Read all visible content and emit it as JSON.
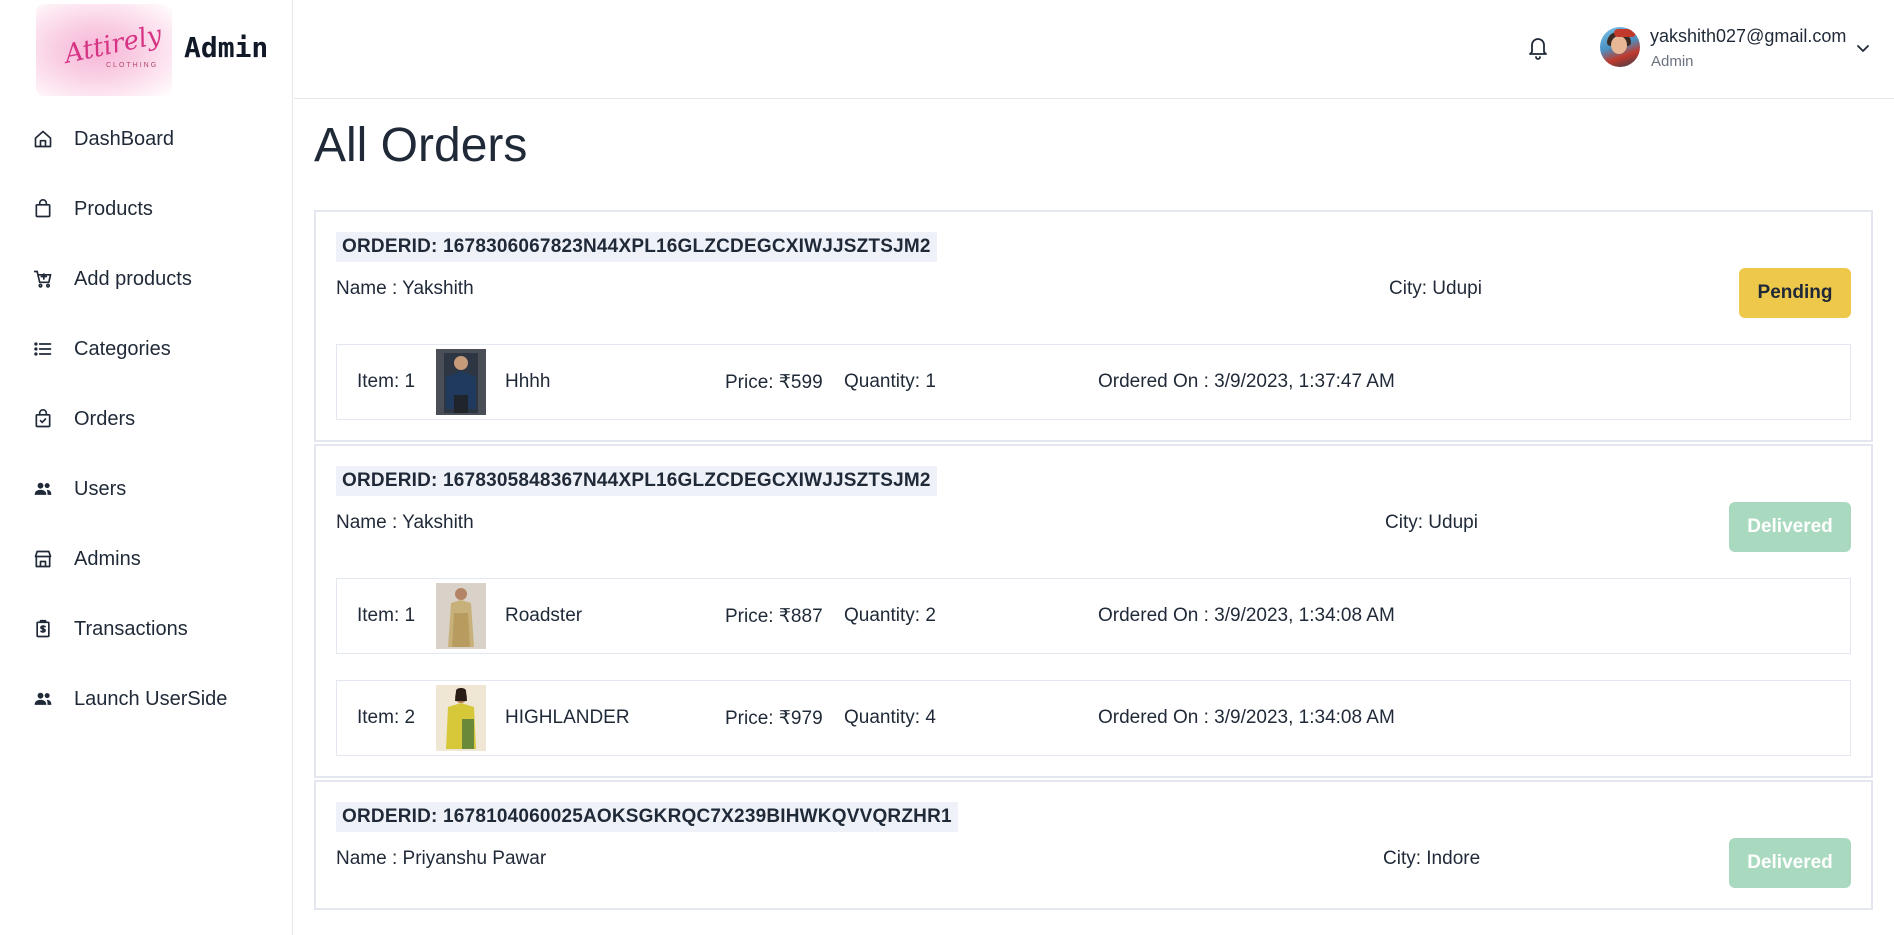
{
  "brand": {
    "logo_text": "Attirely",
    "logo_sub": "CLOTHING",
    "title": "Admin"
  },
  "sidebar": {
    "items": [
      {
        "label": "DashBoard",
        "icon": "home-icon"
      },
      {
        "label": "Products",
        "icon": "shopping-bag-icon"
      },
      {
        "label": "Add products",
        "icon": "cart-add-icon"
      },
      {
        "label": "Categories",
        "icon": "list-icon"
      },
      {
        "label": "Orders",
        "icon": "bag-check-icon"
      },
      {
        "label": "Users",
        "icon": "users-icon"
      },
      {
        "label": "Admins",
        "icon": "store-icon"
      },
      {
        "label": "Transactions",
        "icon": "receipt-icon"
      },
      {
        "label": "Launch UserSide",
        "icon": "users-icon"
      }
    ]
  },
  "header": {
    "notification_icon": "bell-icon",
    "user_email": "yakshith027@gmail.com",
    "user_role": "Admin",
    "dropdown_icon": "chevron-down-icon"
  },
  "page": {
    "title": "All Orders"
  },
  "orders": [
    {
      "order_id": "ORDERID: 1678306067823N44XPL16GLZCDEGCXIWJJSZTSJM2",
      "name": "Name : Yakshith",
      "city": "City: Udupi",
      "status": "Pending",
      "items": [
        {
          "item": "Item: 1",
          "product": "Hhhh",
          "price": "Price: ₹599",
          "quantity": "Quantity: 1",
          "ordered_on": "Ordered On : 3/9/2023, 1:37:47 AM"
        }
      ]
    },
    {
      "order_id": "ORDERID: 1678305848367N44XPL16GLZCDEGCXIWJJSZTSJM2",
      "name": "Name : Yakshith",
      "city": "City: Udupi",
      "status": "Delivered",
      "items": [
        {
          "item": "Item: 1",
          "product": "Roadster",
          "price": "Price: ₹887",
          "quantity": "Quantity: 2",
          "ordered_on": "Ordered On : 3/9/2023, 1:34:08 AM"
        },
        {
          "item": "Item: 2",
          "product": "HIGHLANDER",
          "price": "Price: ₹979",
          "quantity": "Quantity: 4",
          "ordered_on": "Ordered On : 3/9/2023, 1:34:08 AM"
        }
      ]
    },
    {
      "order_id": "ORDERID: 1678104060025AOKSGKRQC7X239BIHWKQVVQRZHR1",
      "name": "Name : Priyanshu Pawar",
      "city": "City: Indore",
      "status": "Delivered",
      "items": []
    }
  ],
  "colors": {
    "pending": "#eec84a",
    "delivered": "#a9d9bf",
    "order_id_bg": "#eef1f7",
    "border": "#e3e7ef"
  }
}
